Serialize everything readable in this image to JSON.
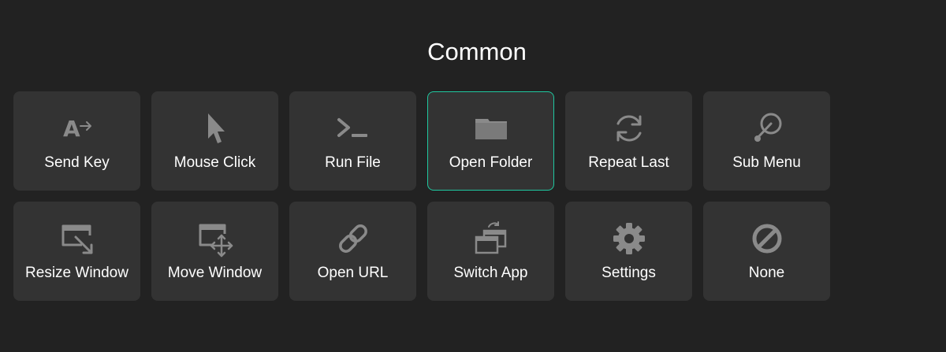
{
  "section": {
    "title": "Common"
  },
  "colors": {
    "background": "#222222",
    "tile": "#333333",
    "icon": "#8a8a8a",
    "selected_border": "#1fc8a0"
  },
  "actions": [
    {
      "label": "Send Key",
      "icon": "send-key-icon"
    },
    {
      "label": "Mouse Click",
      "icon": "cursor-icon"
    },
    {
      "label": "Run File",
      "icon": "terminal-icon"
    },
    {
      "label": "Open Folder",
      "icon": "folder-icon",
      "selected": true
    },
    {
      "label": "Repeat Last",
      "icon": "repeat-icon"
    },
    {
      "label": "Sub Menu",
      "icon": "sub-menu-icon"
    },
    {
      "label": "Resize Window",
      "icon": "resize-window-icon"
    },
    {
      "label": "Move Window",
      "icon": "move-window-icon"
    },
    {
      "label": "Open URL",
      "icon": "link-icon"
    },
    {
      "label": "Switch App",
      "icon": "switch-app-icon"
    },
    {
      "label": "Settings",
      "icon": "gear-icon"
    },
    {
      "label": "None",
      "icon": "none-icon"
    }
  ]
}
